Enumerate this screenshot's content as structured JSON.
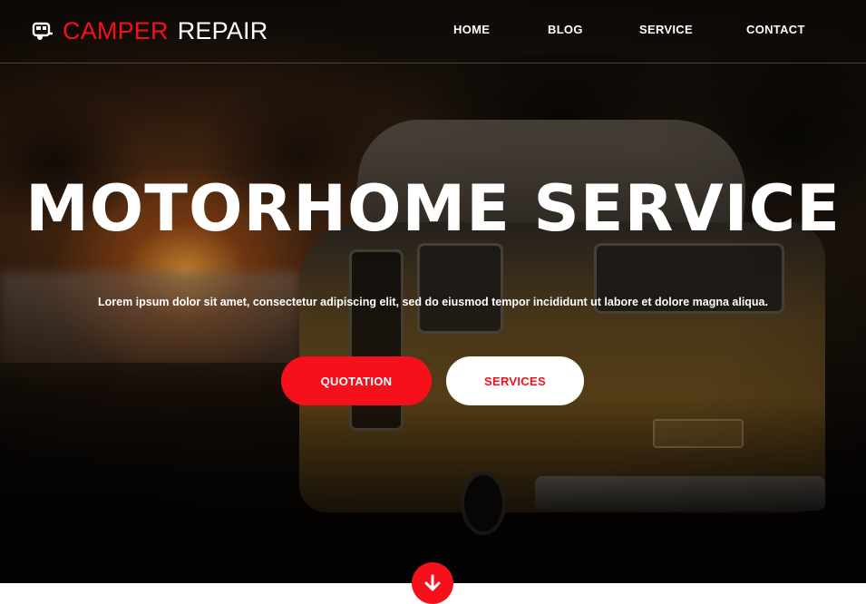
{
  "brand": {
    "name_part1": "CAMPER",
    "name_part2": "REPAIR",
    "icon": "camper-trailer-icon",
    "accent_color": "#f5101c"
  },
  "nav": {
    "items": [
      {
        "label": "HOME"
      },
      {
        "label": "BLOG"
      },
      {
        "label": "SERVICE"
      },
      {
        "label": "CONTACT"
      }
    ]
  },
  "hero": {
    "title": "MOTORHOME SERVICE",
    "text": "Lorem ipsum dolor sit amet, consectetur adipiscing elit, sed do eiusmod tempor incididunt ut labore et dolore magna aliqua.",
    "primary_button": "QUOTATION",
    "secondary_button": "SERVICES",
    "scroll_icon": "arrow-down-icon",
    "background": "camper-van-at-sunset-photo"
  }
}
